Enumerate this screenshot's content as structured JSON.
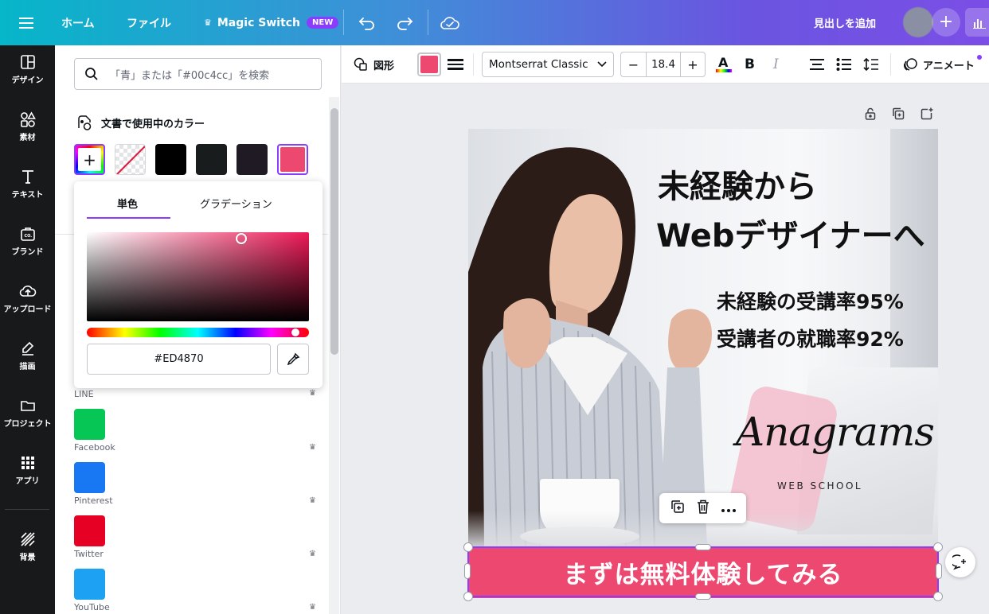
{
  "topbar": {
    "home": "ホーム",
    "file": "ファイル",
    "magic_switch": "Magic Switch",
    "new_badge": "NEW",
    "add_heading": "見出しを追加"
  },
  "leftnav": {
    "items": [
      {
        "label": "デザイン",
        "icon": "layout-icon"
      },
      {
        "label": "素材",
        "icon": "shapes-icon"
      },
      {
        "label": "テキスト",
        "icon": "text-icon"
      },
      {
        "label": "ブランド",
        "icon": "brand-icon"
      },
      {
        "label": "アップロード",
        "icon": "upload-icon"
      },
      {
        "label": "描画",
        "icon": "draw-icon"
      },
      {
        "label": "プロジェクト",
        "icon": "folder-icon"
      },
      {
        "label": "アプリ",
        "icon": "apps-icon"
      },
      {
        "label": "背景",
        "icon": "background-icon"
      }
    ]
  },
  "panel": {
    "search_placeholder": "「青」または「#00c4cc」を検索",
    "doc_colors_title": "文書で使用中のカラー",
    "doc_colors": [
      "transparent",
      "#000000",
      "#181c1c",
      "#1f1a23",
      "#ED4870"
    ],
    "brands": [
      {
        "label": "LINE",
        "color": "#06C755"
      },
      {
        "label": "Facebook",
        "color": "#1877F2"
      },
      {
        "label": "Pinterest",
        "color": "#E60023"
      },
      {
        "label": "Twitter",
        "color": "#1DA1F2"
      },
      {
        "label": "YouTube",
        "color": ""
      }
    ]
  },
  "color_popover": {
    "tab_solid": "単色",
    "tab_gradient": "グラデーション",
    "hex_value": "#ED4870"
  },
  "toolbar": {
    "shape_label": "図形",
    "selected_color": "#ED4870",
    "font_name": "Montserrat Classic",
    "font_size": "18.4",
    "minus": "−",
    "plus": "+",
    "animate_label": "アニメート"
  },
  "design": {
    "headline_1": "未経験から",
    "headline_2": "Webデザイナーへ",
    "stat_1": "未経験の受講率95%",
    "stat_2": "受講者の就職率92%",
    "logo_text": "Anagrams",
    "logo_sub": "WEB SCHOOL",
    "cta": "まずは無料体験してみる",
    "cta_color": "#ED4870"
  }
}
